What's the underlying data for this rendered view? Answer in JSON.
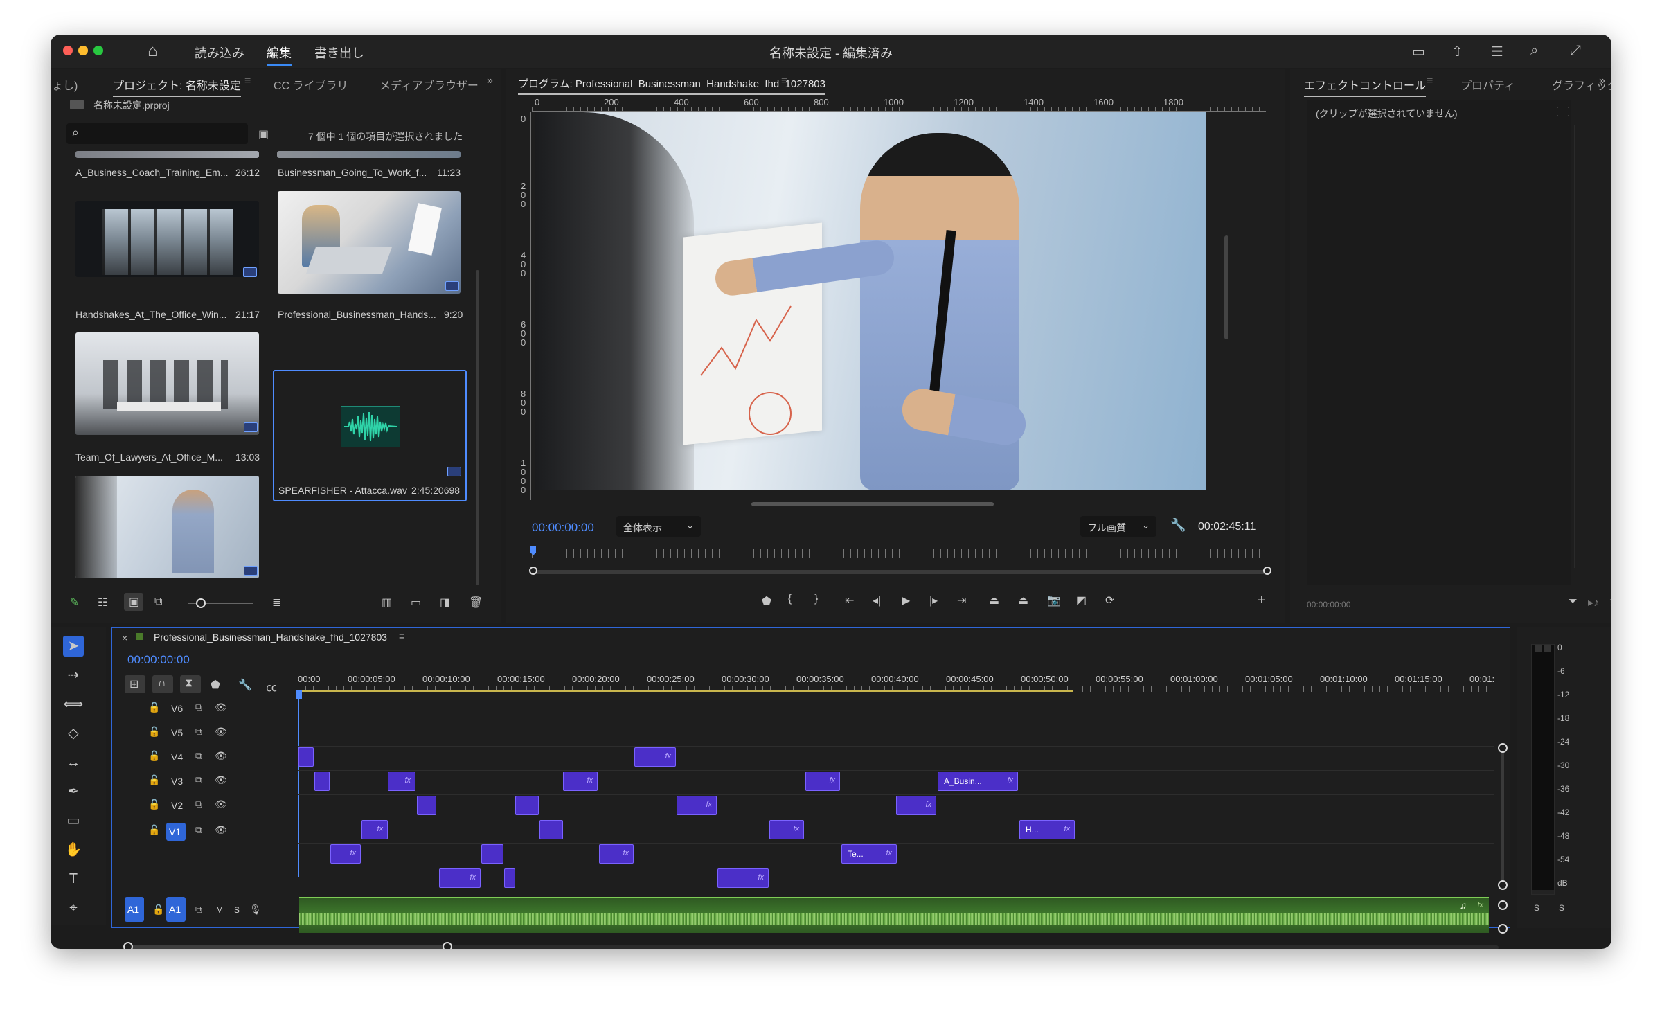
{
  "titlebar": {
    "tabs": [
      "読み込み",
      "編集",
      "書き出し"
    ],
    "active_tab": "編集",
    "title": "名称未設定 - 編集済み"
  },
  "project_panel": {
    "tabs": [
      "ょし)",
      "プロジェクト: 名称未設定",
      "CC ライブラリ",
      "メディアブラウザー"
    ],
    "file": "名称未設定.prproj",
    "search_placeholder": "",
    "selection_status": "7 個中 1 個の項目が選択されました",
    "clips": [
      {
        "name": "A_Business_Coach_Training_Em...",
        "duration": "26:12"
      },
      {
        "name": "Businessman_Going_To_Work_f...",
        "duration": "11:23"
      },
      {
        "name": "Handshakes_At_The_Office_Win...",
        "duration": "21:17"
      },
      {
        "name": "Professional_Businessman_Hands...",
        "duration": "9:20"
      },
      {
        "name": "Team_Of_Lawyers_At_Office_M...",
        "duration": "13:03"
      },
      {
        "name": "SPEARFISHER - Attacca.wav",
        "duration": "2:45:20698"
      }
    ]
  },
  "program_monitor": {
    "title": "プログラム: Professional_Businessman_Handshake_fhd_1027803",
    "ruler_top": [
      "0",
      "200",
      "400",
      "600",
      "800",
      "1000",
      "1200",
      "1400",
      "1600",
      "1800"
    ],
    "ruler_left": [
      "0",
      "200",
      "400",
      "600",
      "800",
      "1000"
    ],
    "timecode": "00:00:00:00",
    "zoom": "全体表示",
    "quality": "フル画質",
    "duration": "00:02:45:11"
  },
  "effect_controls": {
    "tabs": [
      "エフェクトコントロール",
      "プロパティ",
      "グラフィックテン"
    ],
    "empty_message": "(クリップが選択されていません)",
    "timecode": "00:00:00:00"
  },
  "timeline": {
    "sequence_name": "Professional_Businessman_Handshake_fhd_1027803",
    "timecode": "00:00:00:00",
    "ruler": [
      "00:00",
      "00:00:05:00",
      "00:00:10:00",
      "00:00:15:00",
      "00:00:20:00",
      "00:00:25:00",
      "00:00:30:00",
      "00:00:35:00",
      "00:00:40:00",
      "00:00:45:00",
      "00:00:50:00",
      "00:00:55:00",
      "00:01:00:00",
      "00:01:05:00",
      "00:01:10:00",
      "00:01:15:00",
      "00:01:"
    ],
    "tracks": [
      "V6",
      "V5",
      "V4",
      "V3",
      "V2",
      "V1"
    ],
    "audio_track": "A1",
    "audio_source": "A1",
    "audio_buttons": [
      "M",
      "S"
    ],
    "clip_labels": {
      "a_busin": "A_Busin...",
      "h": "H...",
      "te": "Te..."
    },
    "fx_label": "fx"
  },
  "meter": {
    "scale": [
      "0",
      "-6",
      "-12",
      "-18",
      "-24",
      "-30",
      "-36",
      "-42",
      "-48",
      "-54",
      "dB"
    ],
    "solo": [
      "S",
      "S"
    ]
  }
}
